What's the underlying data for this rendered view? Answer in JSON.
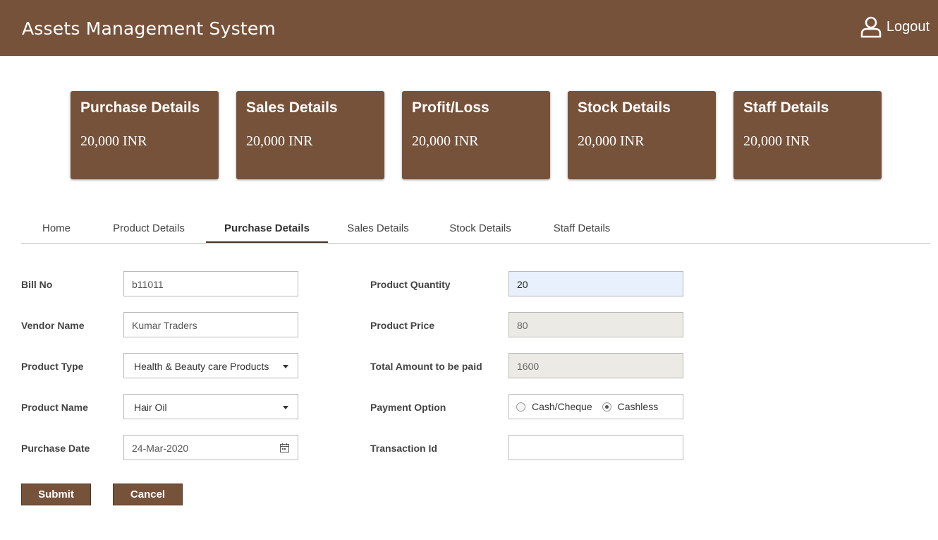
{
  "header": {
    "title": "Assets Management System",
    "logout_label": "Logout"
  },
  "cards": [
    {
      "title": "Purchase Details",
      "value": "20,000 INR"
    },
    {
      "title": "Sales Details",
      "value": "20,000 INR"
    },
    {
      "title": "Profit/Loss",
      "value": "20,000 INR"
    },
    {
      "title": "Stock Details",
      "value": "20,000 INR"
    },
    {
      "title": "Staff Details",
      "value": "20,000 INR"
    }
  ],
  "tabs": [
    {
      "label": "Home"
    },
    {
      "label": "Product Details"
    },
    {
      "label": "Purchase Details",
      "active": true
    },
    {
      "label": "Sales Details"
    },
    {
      "label": "Stock Details"
    },
    {
      "label": "Staff Details"
    }
  ],
  "form": {
    "bill_no": {
      "label": "Bill No",
      "value": "b11011"
    },
    "vendor_name": {
      "label": "Vendor Name",
      "value": "Kumar Traders"
    },
    "product_type": {
      "label": "Product Type",
      "value": "Health & Beauty care Products"
    },
    "product_name": {
      "label": "Product Name",
      "value": "Hair Oil"
    },
    "purchase_date": {
      "label": "Purchase Date",
      "value": "24-Mar-2020"
    },
    "product_quantity": {
      "label": "Product Quantity",
      "value": "20"
    },
    "product_price": {
      "label": "Product Price",
      "value": "80"
    },
    "total_amount": {
      "label": "Total Amount to be paid",
      "value": "1600"
    },
    "payment_option": {
      "label": "Payment Option",
      "options": [
        "Cash/Cheque",
        "Cashless"
      ],
      "selected": "Cashless"
    },
    "transaction_id": {
      "label": "Transaction Id",
      "value": ""
    }
  },
  "buttons": {
    "submit": "Submit",
    "cancel": "Cancel"
  },
  "colors": {
    "brand": "#77523a",
    "input_highlight": "#e8effd",
    "input_readonly": "#ebeae4"
  },
  "icons": {
    "logout": "user-icon",
    "date": "calendar-icon",
    "dropdown": "chevron-down-icon"
  }
}
